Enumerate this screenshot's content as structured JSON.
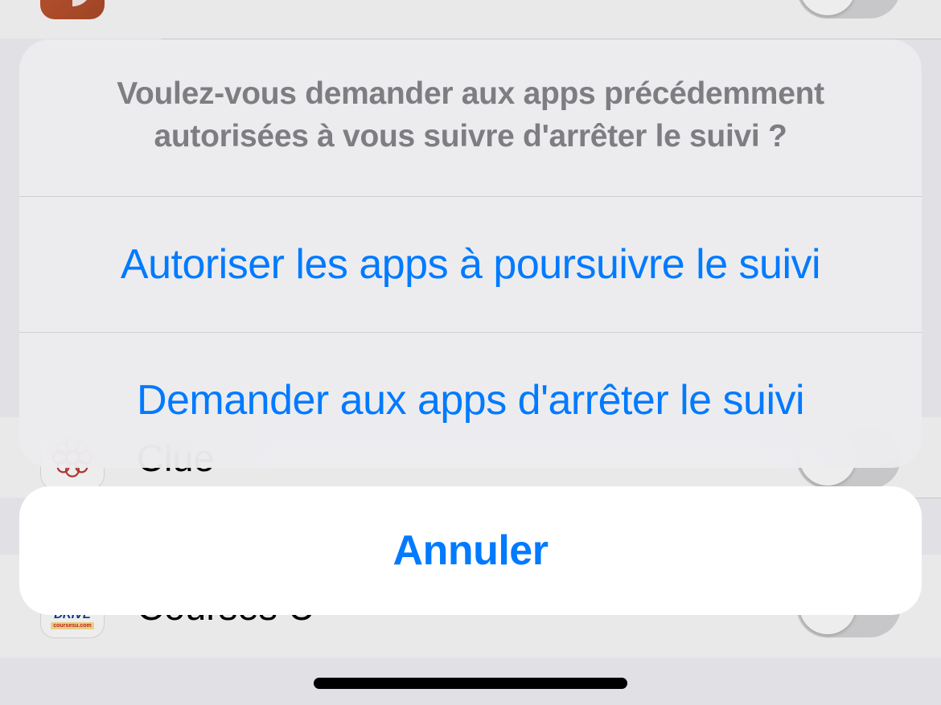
{
  "background": {
    "apps": [
      {
        "label": "",
        "iconType": "orange"
      },
      {
        "label": "Clue",
        "iconType": "clue"
      },
      {
        "label": "Courses U",
        "iconType": "drive"
      }
    ]
  },
  "actionSheet": {
    "title": "Voulez-vous demander aux apps précédemment autorisées à vous suivre d'arrêter le suivi ?",
    "options": [
      {
        "label": "Autoriser les apps à poursuivre le suivi"
      },
      {
        "label": "Demander aux apps d'arrêter le suivi"
      }
    ],
    "cancel": "Annuler"
  },
  "icons": {
    "drive_text": "DRIVE",
    "drive_sub": "coursesu.com",
    "u_letter": "U"
  }
}
